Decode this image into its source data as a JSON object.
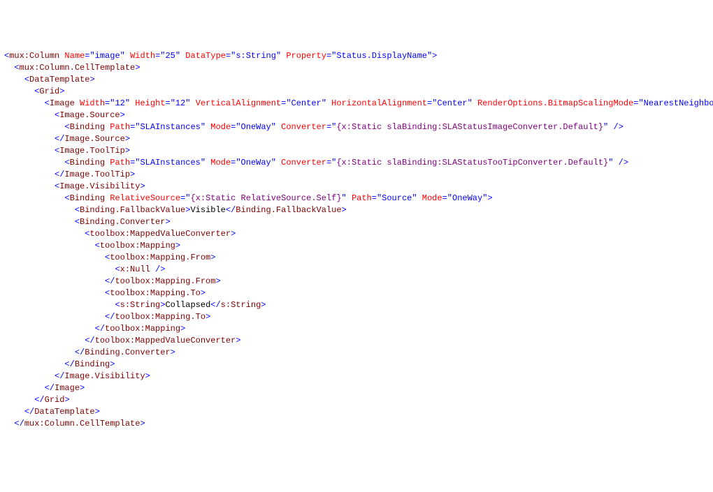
{
  "lines": [
    {
      "indent": 0,
      "tokens": [
        {
          "t": "pun",
          "v": "<"
        },
        {
          "t": "tag",
          "v": "mux:Column"
        },
        {
          "t": "txt",
          "v": " "
        },
        {
          "t": "attr",
          "v": "Name"
        },
        {
          "t": "pun",
          "v": "="
        },
        {
          "t": "pun",
          "v": "\""
        },
        {
          "t": "str",
          "v": "image"
        },
        {
          "t": "pun",
          "v": "\""
        },
        {
          "t": "txt",
          "v": " "
        },
        {
          "t": "attr",
          "v": "Width"
        },
        {
          "t": "pun",
          "v": "="
        },
        {
          "t": "pun",
          "v": "\""
        },
        {
          "t": "str",
          "v": "25"
        },
        {
          "t": "pun",
          "v": "\""
        },
        {
          "t": "txt",
          "v": " "
        },
        {
          "t": "attr",
          "v": "DataType"
        },
        {
          "t": "pun",
          "v": "="
        },
        {
          "t": "pun",
          "v": "\""
        },
        {
          "t": "str",
          "v": "s:String"
        },
        {
          "t": "pun",
          "v": "\""
        },
        {
          "t": "txt",
          "v": " "
        },
        {
          "t": "attr",
          "v": "Property"
        },
        {
          "t": "pun",
          "v": "="
        },
        {
          "t": "pun",
          "v": "\""
        },
        {
          "t": "str",
          "v": "Status.DisplayName"
        },
        {
          "t": "pun",
          "v": "\""
        },
        {
          "t": "pun",
          "v": ">"
        }
      ]
    },
    {
      "indent": 1,
      "tokens": [
        {
          "t": "pun",
          "v": "<"
        },
        {
          "t": "tag",
          "v": "mux:Column.CellTemplate"
        },
        {
          "t": "pun",
          "v": ">"
        }
      ]
    },
    {
      "indent": 2,
      "tokens": [
        {
          "t": "pun",
          "v": "<"
        },
        {
          "t": "tag",
          "v": "DataTemplate"
        },
        {
          "t": "pun",
          "v": ">"
        }
      ]
    },
    {
      "indent": 3,
      "tokens": [
        {
          "t": "pun",
          "v": "<"
        },
        {
          "t": "tag",
          "v": "Grid"
        },
        {
          "t": "pun",
          "v": ">"
        }
      ]
    },
    {
      "indent": 4,
      "tokens": [
        {
          "t": "pun",
          "v": "<"
        },
        {
          "t": "tag",
          "v": "Image"
        },
        {
          "t": "txt",
          "v": " "
        },
        {
          "t": "attr",
          "v": "Width"
        },
        {
          "t": "pun",
          "v": "="
        },
        {
          "t": "pun",
          "v": "\""
        },
        {
          "t": "str",
          "v": "12"
        },
        {
          "t": "pun",
          "v": "\""
        },
        {
          "t": "txt",
          "v": " "
        },
        {
          "t": "attr",
          "v": "Height"
        },
        {
          "t": "pun",
          "v": "="
        },
        {
          "t": "pun",
          "v": "\""
        },
        {
          "t": "str",
          "v": "12"
        },
        {
          "t": "pun",
          "v": "\""
        },
        {
          "t": "txt",
          "v": " "
        },
        {
          "t": "attr",
          "v": "VerticalAlignment"
        },
        {
          "t": "pun",
          "v": "="
        },
        {
          "t": "pun",
          "v": "\""
        },
        {
          "t": "str",
          "v": "Center"
        },
        {
          "t": "pun",
          "v": "\""
        },
        {
          "t": "txt",
          "v": " "
        },
        {
          "t": "attr",
          "v": "HorizontalAlignment"
        },
        {
          "t": "pun",
          "v": "="
        },
        {
          "t": "pun",
          "v": "\""
        },
        {
          "t": "str",
          "v": "Center"
        },
        {
          "t": "pun",
          "v": "\""
        },
        {
          "t": "txt",
          "v": " "
        },
        {
          "t": "attr",
          "v": "RenderOptions.BitmapScalingMode"
        },
        {
          "t": "pun",
          "v": "="
        },
        {
          "t": "pun",
          "v": "\""
        },
        {
          "t": "str",
          "v": "NearestNeighbor"
        },
        {
          "t": "pun",
          "v": "\""
        },
        {
          "t": "pun",
          "v": ">"
        }
      ]
    },
    {
      "indent": 5,
      "tokens": [
        {
          "t": "pun",
          "v": "<"
        },
        {
          "t": "tag",
          "v": "Image.Source"
        },
        {
          "t": "pun",
          "v": ">"
        }
      ]
    },
    {
      "indent": 6,
      "tokens": [
        {
          "t": "pun",
          "v": "<"
        },
        {
          "t": "tag",
          "v": "Binding"
        },
        {
          "t": "txt",
          "v": " "
        },
        {
          "t": "attr",
          "v": "Path"
        },
        {
          "t": "pun",
          "v": "="
        },
        {
          "t": "pun",
          "v": "\""
        },
        {
          "t": "str",
          "v": "SLAInstances"
        },
        {
          "t": "pun",
          "v": "\""
        },
        {
          "t": "txt",
          "v": " "
        },
        {
          "t": "attr",
          "v": "Mode"
        },
        {
          "t": "pun",
          "v": "="
        },
        {
          "t": "pun",
          "v": "\""
        },
        {
          "t": "str",
          "v": "OneWay"
        },
        {
          "t": "pun",
          "v": "\""
        },
        {
          "t": "txt",
          "v": " "
        },
        {
          "t": "attr",
          "v": "Converter"
        },
        {
          "t": "pun",
          "v": "="
        },
        {
          "t": "pun",
          "v": "\""
        },
        {
          "t": "str-purple",
          "v": "{x:Static slaBinding:SLAStatusImageConverter.Default}"
        },
        {
          "t": "pun",
          "v": "\""
        },
        {
          "t": "txt",
          "v": " "
        },
        {
          "t": "pun",
          "v": "/>"
        }
      ]
    },
    {
      "indent": 5,
      "tokens": [
        {
          "t": "pun",
          "v": "</"
        },
        {
          "t": "tag",
          "v": "Image.Source"
        },
        {
          "t": "pun",
          "v": ">"
        }
      ]
    },
    {
      "indent": 5,
      "tokens": [
        {
          "t": "pun",
          "v": "<"
        },
        {
          "t": "tag",
          "v": "Image.ToolTip"
        },
        {
          "t": "pun",
          "v": ">"
        }
      ]
    },
    {
      "indent": 6,
      "tokens": [
        {
          "t": "pun",
          "v": "<"
        },
        {
          "t": "tag",
          "v": "Binding"
        },
        {
          "t": "txt",
          "v": " "
        },
        {
          "t": "attr",
          "v": "Path"
        },
        {
          "t": "pun",
          "v": "="
        },
        {
          "t": "pun",
          "v": "\""
        },
        {
          "t": "str",
          "v": "SLAInstances"
        },
        {
          "t": "pun",
          "v": "\""
        },
        {
          "t": "txt",
          "v": " "
        },
        {
          "t": "attr",
          "v": "Mode"
        },
        {
          "t": "pun",
          "v": "="
        },
        {
          "t": "pun",
          "v": "\""
        },
        {
          "t": "str",
          "v": "OneWay"
        },
        {
          "t": "pun",
          "v": "\""
        },
        {
          "t": "txt",
          "v": " "
        },
        {
          "t": "attr",
          "v": "Converter"
        },
        {
          "t": "pun",
          "v": "="
        },
        {
          "t": "pun",
          "v": "\""
        },
        {
          "t": "str-purple",
          "v": "{x:Static slaBinding:SLAStatusTooTipConverter.Default}"
        },
        {
          "t": "pun",
          "v": "\""
        },
        {
          "t": "txt",
          "v": " "
        },
        {
          "t": "pun",
          "v": "/>"
        }
      ]
    },
    {
      "indent": 5,
      "tokens": [
        {
          "t": "pun",
          "v": "</"
        },
        {
          "t": "tag",
          "v": "Image.ToolTip"
        },
        {
          "t": "pun",
          "v": ">"
        }
      ]
    },
    {
      "indent": 5,
      "tokens": [
        {
          "t": "pun",
          "v": "<"
        },
        {
          "t": "tag",
          "v": "Image.Visibility"
        },
        {
          "t": "pun",
          "v": ">"
        }
      ]
    },
    {
      "indent": 6,
      "tokens": [
        {
          "t": "pun",
          "v": "<"
        },
        {
          "t": "tag",
          "v": "Binding"
        },
        {
          "t": "txt",
          "v": " "
        },
        {
          "t": "attr",
          "v": "RelativeSource"
        },
        {
          "t": "pun",
          "v": "="
        },
        {
          "t": "pun",
          "v": "\""
        },
        {
          "t": "str-purple",
          "v": "{x:Static RelativeSource.Self}"
        },
        {
          "t": "pun",
          "v": "\""
        },
        {
          "t": "txt",
          "v": " "
        },
        {
          "t": "attr",
          "v": "Path"
        },
        {
          "t": "pun",
          "v": "="
        },
        {
          "t": "pun",
          "v": "\""
        },
        {
          "t": "str",
          "v": "Source"
        },
        {
          "t": "pun",
          "v": "\""
        },
        {
          "t": "txt",
          "v": " "
        },
        {
          "t": "attr",
          "v": "Mode"
        },
        {
          "t": "pun",
          "v": "="
        },
        {
          "t": "pun",
          "v": "\""
        },
        {
          "t": "str",
          "v": "OneWay"
        },
        {
          "t": "pun",
          "v": "\""
        },
        {
          "t": "pun",
          "v": ">"
        }
      ]
    },
    {
      "indent": 7,
      "tokens": [
        {
          "t": "pun",
          "v": "<"
        },
        {
          "t": "tag",
          "v": "Binding.FallbackValue"
        },
        {
          "t": "pun",
          "v": ">"
        },
        {
          "t": "txt",
          "v": "Visible"
        },
        {
          "t": "pun",
          "v": "</"
        },
        {
          "t": "tag",
          "v": "Binding.FallbackValue"
        },
        {
          "t": "pun",
          "v": ">"
        }
      ]
    },
    {
      "indent": 7,
      "tokens": [
        {
          "t": "pun",
          "v": "<"
        },
        {
          "t": "tag",
          "v": "Binding.Converter"
        },
        {
          "t": "pun",
          "v": ">"
        }
      ]
    },
    {
      "indent": 8,
      "tokens": [
        {
          "t": "pun",
          "v": "<"
        },
        {
          "t": "tag",
          "v": "toolbox:MappedValueConverter"
        },
        {
          "t": "pun",
          "v": ">"
        }
      ]
    },
    {
      "indent": 9,
      "tokens": [
        {
          "t": "pun",
          "v": "<"
        },
        {
          "t": "tag",
          "v": "toolbox:Mapping"
        },
        {
          "t": "pun",
          "v": ">"
        }
      ]
    },
    {
      "indent": 10,
      "tokens": [
        {
          "t": "pun",
          "v": "<"
        },
        {
          "t": "tag",
          "v": "toolbox:Mapping.From"
        },
        {
          "t": "pun",
          "v": ">"
        }
      ]
    },
    {
      "indent": 11,
      "tokens": [
        {
          "t": "pun",
          "v": "<"
        },
        {
          "t": "tag",
          "v": "x:Null"
        },
        {
          "t": "txt",
          "v": " "
        },
        {
          "t": "pun",
          "v": "/>"
        }
      ]
    },
    {
      "indent": 10,
      "tokens": [
        {
          "t": "pun",
          "v": "</"
        },
        {
          "t": "tag",
          "v": "toolbox:Mapping.From"
        },
        {
          "t": "pun",
          "v": ">"
        }
      ]
    },
    {
      "indent": 10,
      "tokens": [
        {
          "t": "pun",
          "v": "<"
        },
        {
          "t": "tag",
          "v": "toolbox:Mapping.To"
        },
        {
          "t": "pun",
          "v": ">"
        }
      ]
    },
    {
      "indent": 11,
      "tokens": [
        {
          "t": "pun",
          "v": "<"
        },
        {
          "t": "tag",
          "v": "s:String"
        },
        {
          "t": "pun",
          "v": ">"
        },
        {
          "t": "txt",
          "v": "Collapsed"
        },
        {
          "t": "pun",
          "v": "</"
        },
        {
          "t": "tag",
          "v": "s:String"
        },
        {
          "t": "pun",
          "v": ">"
        }
      ]
    },
    {
      "indent": 10,
      "tokens": [
        {
          "t": "pun",
          "v": "</"
        },
        {
          "t": "tag",
          "v": "toolbox:Mapping.To"
        },
        {
          "t": "pun",
          "v": ">"
        }
      ]
    },
    {
      "indent": 9,
      "tokens": [
        {
          "t": "pun",
          "v": "</"
        },
        {
          "t": "tag",
          "v": "toolbox:Mapping"
        },
        {
          "t": "pun",
          "v": ">"
        }
      ]
    },
    {
      "indent": 8,
      "tokens": [
        {
          "t": "pun",
          "v": "</"
        },
        {
          "t": "tag",
          "v": "toolbox:MappedValueConverter"
        },
        {
          "t": "pun",
          "v": ">"
        }
      ]
    },
    {
      "indent": 7,
      "tokens": [
        {
          "t": "pun",
          "v": "</"
        },
        {
          "t": "tag",
          "v": "Binding.Converter"
        },
        {
          "t": "pun",
          "v": ">"
        }
      ]
    },
    {
      "indent": 6,
      "tokens": [
        {
          "t": "pun",
          "v": "</"
        },
        {
          "t": "tag",
          "v": "Binding"
        },
        {
          "t": "pun",
          "v": ">"
        }
      ]
    },
    {
      "indent": 5,
      "tokens": [
        {
          "t": "pun",
          "v": "</"
        },
        {
          "t": "tag",
          "v": "Image.Visibility"
        },
        {
          "t": "pun",
          "v": ">"
        }
      ]
    },
    {
      "indent": 4,
      "tokens": [
        {
          "t": "pun",
          "v": "</"
        },
        {
          "t": "tag",
          "v": "Image"
        },
        {
          "t": "pun",
          "v": ">"
        }
      ]
    },
    {
      "indent": 3,
      "tokens": [
        {
          "t": "pun",
          "v": "</"
        },
        {
          "t": "tag",
          "v": "Grid"
        },
        {
          "t": "pun",
          "v": ">"
        }
      ]
    },
    {
      "indent": 2,
      "tokens": [
        {
          "t": "pun",
          "v": "</"
        },
        {
          "t": "tag",
          "v": "DataTemplate"
        },
        {
          "t": "pun",
          "v": ">"
        }
      ]
    },
    {
      "indent": 1,
      "tokens": [
        {
          "t": "pun",
          "v": "</"
        },
        {
          "t": "tag",
          "v": "mux:Column.CellTemplate"
        },
        {
          "t": "pun",
          "v": ">"
        }
      ]
    }
  ],
  "indent_unit": "  "
}
